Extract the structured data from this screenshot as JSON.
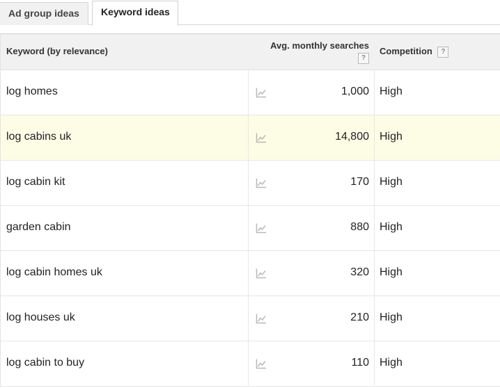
{
  "tabs": [
    {
      "label": "Ad group ideas",
      "active": false
    },
    {
      "label": "Keyword ideas",
      "active": true
    }
  ],
  "table": {
    "headers": {
      "keyword": "Keyword (by relevance)",
      "avg_monthly_searches": "Avg. monthly searches",
      "competition": "Competition",
      "help_glyph": "?"
    },
    "rows": [
      {
        "keyword": "log homes",
        "searches": "1,000",
        "competition": "High",
        "highlighted": false
      },
      {
        "keyword": "log cabins uk",
        "searches": "14,800",
        "competition": "High",
        "highlighted": true
      },
      {
        "keyword": "log cabin kit",
        "searches": "170",
        "competition": "High",
        "highlighted": false
      },
      {
        "keyword": "garden cabin",
        "searches": "880",
        "competition": "High",
        "highlighted": false
      },
      {
        "keyword": "log cabin homes uk",
        "searches": "320",
        "competition": "High",
        "highlighted": false
      },
      {
        "keyword": "log houses uk",
        "searches": "210",
        "competition": "High",
        "highlighted": false
      },
      {
        "keyword": "log cabin to buy",
        "searches": "110",
        "competition": "High",
        "highlighted": false
      }
    ]
  },
  "icons": {
    "trend": "line-chart-icon",
    "help": "help-icon"
  },
  "colors": {
    "highlight_row": "#fdfde6",
    "header_bg": "#f1f1f1",
    "tab_bg": "#f1f1f1"
  }
}
